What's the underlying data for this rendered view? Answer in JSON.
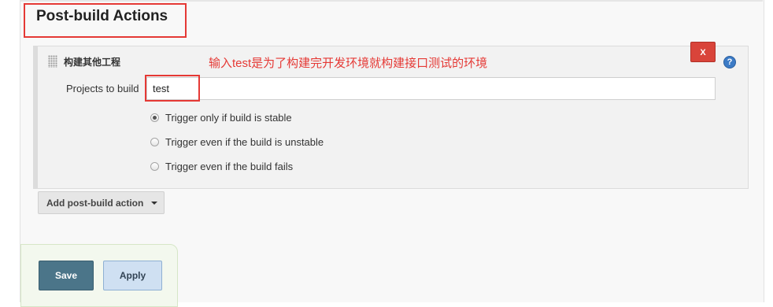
{
  "section": {
    "title": "Post-build Actions"
  },
  "action": {
    "title": "构建其他工程",
    "annotation": "输入test是为了构建完开发环境就构建接口测试的环境",
    "delete_label": "X",
    "help_label": "?",
    "projects_label": "Projects to build",
    "projects_value": "test",
    "trigger_options": [
      {
        "label": "Trigger only if build is stable",
        "selected": true
      },
      {
        "label": "Trigger even if the build is unstable",
        "selected": false
      },
      {
        "label": "Trigger even if the build fails",
        "selected": false
      }
    ]
  },
  "add_action": {
    "label": "Add post-build action"
  },
  "footer": {
    "save_label": "Save",
    "apply_label": "Apply"
  },
  "colors": {
    "annotation": "#e53935",
    "save": "#4b7589",
    "apply": "#cfe0f2",
    "delete": "#d9443a"
  }
}
